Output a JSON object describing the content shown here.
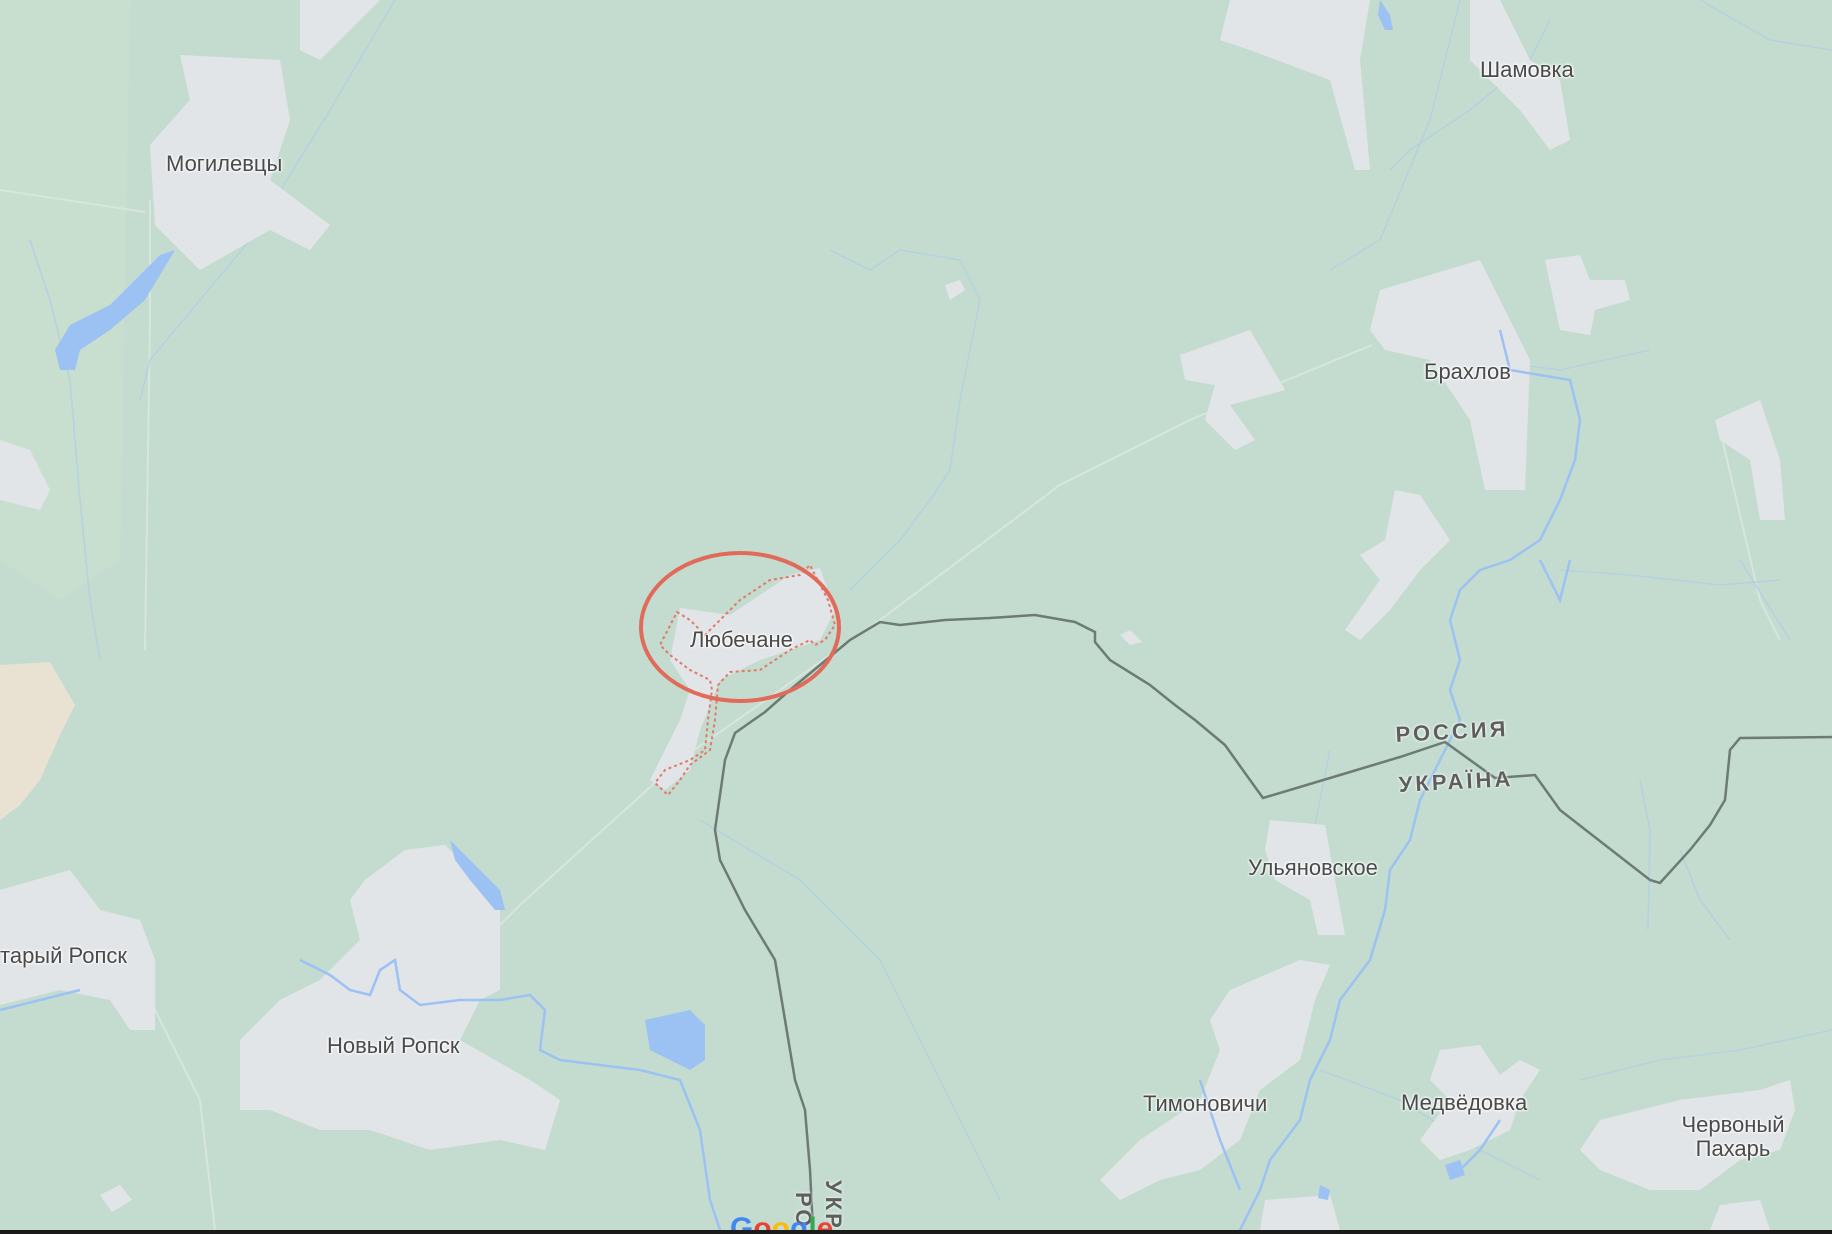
{
  "map": {
    "colors": {
      "forest": "#c4dccf",
      "settlement": "#e2e5e8",
      "water": "#9cc1f3",
      "border": "#6c7b73",
      "highlight_circle": "#e26a5a",
      "boundary": "#e07a6a"
    },
    "places": {
      "mogilevtsy": "Могилевцы",
      "shamovka": "Шамовка",
      "brakhlov": "Брахлов",
      "lyubechane": "Любечане",
      "stary_ropsk": "тарый Ропск",
      "novy_ropsk": "Новый Ропск",
      "ulyanovskoe": "Ульяновское",
      "timonovichi": "Тимоновичи",
      "medvedovka": "Медвёдовка",
      "chervony_pakhar": "Червоный\nПахарь"
    },
    "countries": {
      "russia": "РОССИЯ",
      "ukraine": "УКРАЇНА",
      "ukr_vertical": "УКР",
      "ros_vertical": "РО"
    },
    "logo": "Google"
  }
}
